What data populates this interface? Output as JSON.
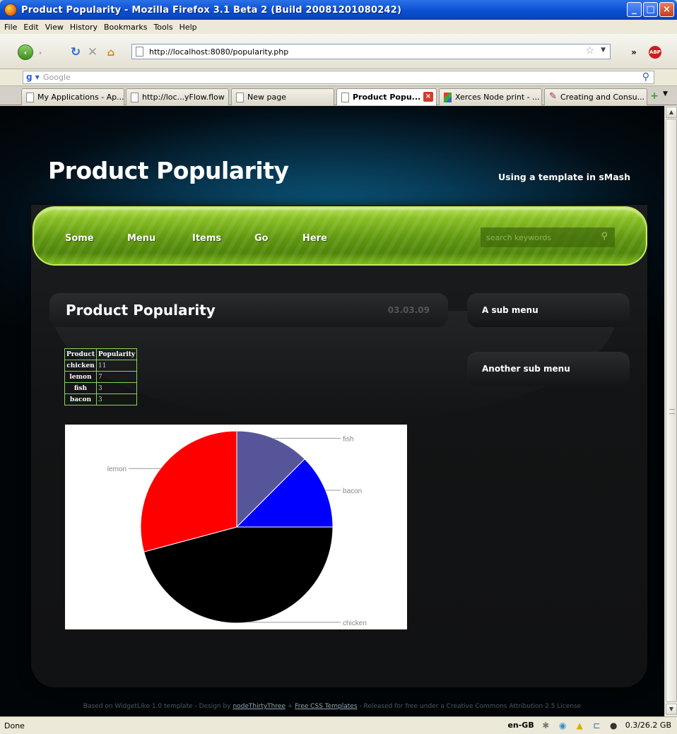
{
  "window": {
    "title": "Product Popularity - Mozilla Firefox 3.1 Beta 2 (Build 20081201080242)",
    "controls": [
      "_",
      "□",
      "×"
    ]
  },
  "menu": [
    "File",
    "Edit",
    "View",
    "History",
    "Bookmarks",
    "Tools",
    "Help"
  ],
  "nav": {
    "url": "http://localhost:8080/popularity.php",
    "search_placeholder": "Google"
  },
  "tabs": [
    {
      "label": "My Applications - Ap..."
    },
    {
      "label": "http://loc...yFlow.flow"
    },
    {
      "label": "New page"
    },
    {
      "label": "Product Popu..."
    },
    {
      "label": "Xerces Node print - ..."
    },
    {
      "label": "Creating and Consu..."
    }
  ],
  "site": {
    "title": "Product Popularity",
    "tagline": "Using a template in sMash",
    "menu": [
      "Some",
      "Menu",
      "Items",
      "Go",
      "Here"
    ],
    "search_placeholder": "search keywords",
    "content_title": "Product Popularity",
    "date": "03.03.09",
    "sub_menus": [
      "A sub menu",
      "Another sub menu"
    ]
  },
  "table": {
    "headers": [
      "Product",
      "Popularity"
    ],
    "rows": [
      [
        "chicken",
        "11"
      ],
      [
        "lemon",
        "7"
      ],
      [
        "fish",
        "3"
      ],
      [
        "bacon",
        "3"
      ]
    ]
  },
  "chart_data": {
    "type": "pie",
    "categories": [
      "fish",
      "bacon",
      "chicken",
      "lemon"
    ],
    "values": [
      3,
      3,
      11,
      7
    ],
    "colors": [
      "#575599",
      "#0000ff",
      "#000000",
      "#ff0000"
    ],
    "title": ""
  },
  "footer": {
    "prefix": "Based on WidgetLike 1.0 template - Design by ",
    "link1": "nodeThirtyThree",
    "plus": " + ",
    "link2": "Free CSS Templates",
    "suffix": " - Released for free under a Creative Commons Attribution 2.5 License"
  },
  "status": {
    "text": "Done",
    "lang": "en-GB",
    "memory": "0.3/26.2 GB"
  }
}
